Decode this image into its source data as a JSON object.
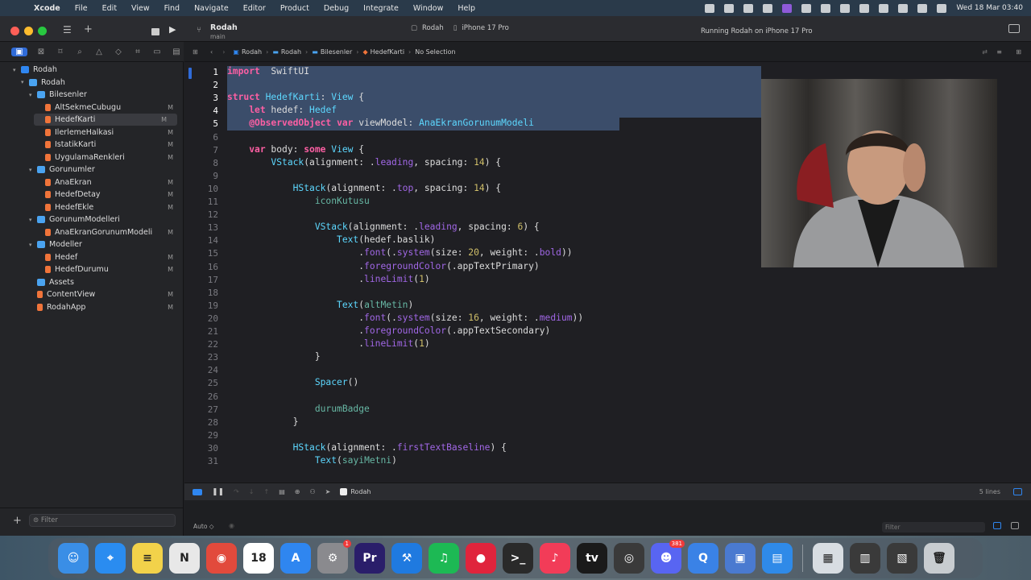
{
  "menubar": {
    "app": "Xcode",
    "items": [
      "File",
      "Edit",
      "View",
      "Find",
      "Navigate",
      "Editor",
      "Product",
      "Debug",
      "Integrate",
      "Window",
      "Help"
    ],
    "clock": "Wed 18 Mar  03:40"
  },
  "toolbar": {
    "project": "Rodah",
    "branch": "main",
    "scheme": "Rodah",
    "device": "iPhone 17 Pro",
    "status": "Running Rodah on iPhone 17 Pro"
  },
  "breadcrumb": {
    "items": [
      "Rodah",
      "Rodah",
      "Bilesenler",
      "HedefKarti"
    ],
    "tail": "No Selection"
  },
  "navigator": {
    "rows": [
      {
        "label": "Rodah",
        "depth": 0,
        "kind": "project",
        "open": true,
        "mark": ""
      },
      {
        "label": "Rodah",
        "depth": 1,
        "kind": "folder",
        "open": true,
        "mark": ""
      },
      {
        "label": "Bilesenler",
        "depth": 2,
        "kind": "folder",
        "open": true,
        "mark": ""
      },
      {
        "label": "AltSekmeCubugu",
        "depth": 3,
        "kind": "swift",
        "mark": "M"
      },
      {
        "label": "HedefKarti",
        "depth": 3,
        "kind": "swift",
        "mark": "M",
        "selected": true
      },
      {
        "label": "IlerlemeHalkasi",
        "depth": 3,
        "kind": "swift",
        "mark": "M"
      },
      {
        "label": "IstatikKarti",
        "depth": 3,
        "kind": "swift",
        "mark": "M"
      },
      {
        "label": "UygulamaRenkleri",
        "depth": 3,
        "kind": "swift",
        "mark": "M"
      },
      {
        "label": "Gorunumler",
        "depth": 2,
        "kind": "folder",
        "open": true,
        "mark": ""
      },
      {
        "label": "AnaEkran",
        "depth": 3,
        "kind": "swift",
        "mark": "M"
      },
      {
        "label": "HedefDetay",
        "depth": 3,
        "kind": "swift",
        "mark": "M"
      },
      {
        "label": "HedefEkle",
        "depth": 3,
        "kind": "swift",
        "mark": "M"
      },
      {
        "label": "GorunumModelleri",
        "depth": 2,
        "kind": "folder",
        "open": true,
        "mark": ""
      },
      {
        "label": "AnaEkranGorunumModeli",
        "depth": 3,
        "kind": "swift",
        "mark": "M"
      },
      {
        "label": "Modeller",
        "depth": 2,
        "kind": "folder",
        "open": true,
        "mark": ""
      },
      {
        "label": "Hedef",
        "depth": 3,
        "kind": "swift",
        "mark": "M"
      },
      {
        "label": "HedefDurumu",
        "depth": 3,
        "kind": "swift",
        "mark": "M"
      },
      {
        "label": "Assets",
        "depth": 2,
        "kind": "assets",
        "mark": ""
      },
      {
        "label": "ContentView",
        "depth": 2,
        "kind": "swift",
        "mark": "M"
      },
      {
        "label": "RodahApp",
        "depth": 2,
        "kind": "swift",
        "mark": "M"
      }
    ],
    "filter_placeholder": "Filter"
  },
  "editor": {
    "selected_lines": [
      1,
      5
    ],
    "lines": [
      [
        [
          "kw",
          "import"
        ],
        [
          "",
          "  SwiftUI"
        ]
      ],
      [],
      [
        [
          "kw",
          "struct"
        ],
        [
          "",
          " "
        ],
        [
          "ty",
          "HedefKarti"
        ],
        [
          "",
          ": "
        ],
        [
          "ty",
          "View"
        ],
        [
          "",
          " {"
        ]
      ],
      [
        [
          "",
          "    "
        ],
        [
          "kw",
          "let"
        ],
        [
          "",
          " hedef: "
        ],
        [
          "ty",
          "Hedef"
        ]
      ],
      [
        [
          "",
          "    "
        ],
        [
          "kw",
          "@ObservedObject"
        ],
        [
          "",
          " "
        ],
        [
          "kw",
          "var"
        ],
        [
          "",
          " viewModel: "
        ],
        [
          "ty",
          "AnaEkranGorunumModeli"
        ]
      ],
      [],
      [
        [
          "",
          "    "
        ],
        [
          "kw",
          "var"
        ],
        [
          "",
          " body: "
        ],
        [
          "kw",
          "some"
        ],
        [
          "",
          " "
        ],
        [
          "ty",
          "View"
        ],
        [
          "",
          " {"
        ]
      ],
      [
        [
          "",
          "        "
        ],
        [
          "ty",
          "VStack"
        ],
        [
          "",
          "(alignment: ."
        ],
        [
          "pr",
          "leading"
        ],
        [
          "",
          ", spacing: "
        ],
        [
          "nm",
          "14"
        ],
        [
          "",
          ") {"
        ]
      ],
      [],
      [
        [
          "",
          "            "
        ],
        [
          "ty",
          "HStack"
        ],
        [
          "",
          "(alignment: ."
        ],
        [
          "pr",
          "top"
        ],
        [
          "",
          ", spacing: "
        ],
        [
          "nm",
          "14"
        ],
        [
          "",
          ") {"
        ]
      ],
      [
        [
          "",
          "                "
        ],
        [
          "fn",
          "iconKutusu"
        ]
      ],
      [],
      [
        [
          "",
          "                "
        ],
        [
          "ty",
          "VStack"
        ],
        [
          "",
          "(alignment: ."
        ],
        [
          "pr",
          "leading"
        ],
        [
          "",
          ", spacing: "
        ],
        [
          "nm",
          "6"
        ],
        [
          "",
          ") {"
        ]
      ],
      [
        [
          "",
          "                    "
        ],
        [
          "ty",
          "Text"
        ],
        [
          "",
          "(hedef.baslik)"
        ]
      ],
      [
        [
          "",
          "                        ."
        ],
        [
          "pr",
          "font"
        ],
        [
          "",
          "(."
        ],
        [
          "pr",
          "system"
        ],
        [
          "",
          "(size: "
        ],
        [
          "nm",
          "20"
        ],
        [
          "",
          ", weight: ."
        ],
        [
          "pr",
          "bold"
        ],
        [
          "",
          "))"
        ]
      ],
      [
        [
          "",
          "                        ."
        ],
        [
          "pr",
          "foregroundColor"
        ],
        [
          "",
          "(.appTextPrimary)"
        ]
      ],
      [
        [
          "",
          "                        ."
        ],
        [
          "pr",
          "lineLimit"
        ],
        [
          "",
          "("
        ],
        [
          "nm",
          "1"
        ],
        [
          "",
          ")"
        ]
      ],
      [],
      [
        [
          "",
          "                    "
        ],
        [
          "ty",
          "Text"
        ],
        [
          "",
          "("
        ],
        [
          "fn",
          "altMetin"
        ],
        [
          "",
          ")"
        ]
      ],
      [
        [
          "",
          "                        ."
        ],
        [
          "pr",
          "font"
        ],
        [
          "",
          "(."
        ],
        [
          "pr",
          "system"
        ],
        [
          "",
          "(size: "
        ],
        [
          "nm",
          "16"
        ],
        [
          "",
          ", weight: ."
        ],
        [
          "pr",
          "medium"
        ],
        [
          "",
          "))"
        ]
      ],
      [
        [
          "",
          "                        ."
        ],
        [
          "pr",
          "foregroundColor"
        ],
        [
          "",
          "(.appTextSecondary)"
        ]
      ],
      [
        [
          "",
          "                        ."
        ],
        [
          "pr",
          "lineLimit"
        ],
        [
          "",
          "("
        ],
        [
          "nm",
          "1"
        ],
        [
          "",
          ")"
        ]
      ],
      [
        [
          "",
          "                }"
        ]
      ],
      [],
      [
        [
          "",
          "                "
        ],
        [
          "ty",
          "Spacer"
        ],
        [
          "",
          "()"
        ]
      ],
      [],
      [
        [
          "",
          "                "
        ],
        [
          "fn",
          "durumBadge"
        ]
      ],
      [
        [
          "",
          "            }"
        ]
      ],
      [],
      [
        [
          "",
          "            "
        ],
        [
          "ty",
          "HStack"
        ],
        [
          "",
          "(alignment: ."
        ],
        [
          "pr",
          "firstTextBaseline"
        ],
        [
          "",
          ") {"
        ]
      ],
      [
        [
          "",
          "                "
        ],
        [
          "ty",
          "Text"
        ],
        [
          "",
          "("
        ],
        [
          "fn",
          "sayiMetni"
        ],
        [
          "",
          ")"
        ]
      ]
    ]
  },
  "debugbar": {
    "target": "Rodah",
    "lines_info": "5 lines"
  },
  "console": {
    "mode": "Auto ◇",
    "filter_placeholder": "Filter"
  },
  "dock": {
    "apps": [
      {
        "name": "finder",
        "glyph": "☺",
        "color": "#3a8ee6"
      },
      {
        "name": "safari",
        "glyph": "⌖",
        "color": "#2a8cf0"
      },
      {
        "name": "notes",
        "glyph": "≡",
        "color": "#f2d24a"
      },
      {
        "name": "news",
        "glyph": "N",
        "color": "#e8e8e8"
      },
      {
        "name": "chrome",
        "glyph": "◉",
        "color": "#e24a3c"
      },
      {
        "name": "calendar",
        "glyph": "18",
        "color": "#ffffff"
      },
      {
        "name": "app-store",
        "glyph": "A",
        "color": "#2f86f0"
      },
      {
        "name": "system-settings",
        "glyph": "⚙",
        "color": "#8a8a8e",
        "badge": "1"
      },
      {
        "name": "premiere",
        "glyph": "Pr",
        "color": "#2a1e6a"
      },
      {
        "name": "xcode",
        "glyph": "⚒",
        "color": "#1f7ae0"
      },
      {
        "name": "spotify",
        "glyph": "♫",
        "color": "#1db954"
      },
      {
        "name": "screen-recorder",
        "glyph": "●",
        "color": "#e0243c"
      },
      {
        "name": "terminal",
        "glyph": ">_",
        "color": "#2a2a2a"
      },
      {
        "name": "music",
        "glyph": "♪",
        "color": "#f23c58"
      },
      {
        "name": "apple-tv",
        "glyph": "tv",
        "color": "#1a1a1a"
      },
      {
        "name": "obs",
        "glyph": "◎",
        "color": "#3a3a3a"
      },
      {
        "name": "discord",
        "glyph": "☻",
        "color": "#5865f2",
        "badge": "381"
      },
      {
        "name": "quicktime",
        "glyph": "Q",
        "color": "#3a82e6"
      },
      {
        "name": "simulator",
        "glyph": "▣",
        "color": "#4a7ad0"
      },
      {
        "name": "files",
        "glyph": "▤",
        "color": "#2f8ae8"
      },
      {
        "name": "preview-docs",
        "glyph": "▦",
        "color": "#d8dde2"
      },
      {
        "name": "window-stack",
        "glyph": "▥",
        "color": "#3a3a3a"
      },
      {
        "name": "window-stack-2",
        "glyph": "▧",
        "color": "#3a3a3a"
      },
      {
        "name": "trash",
        "glyph": "🗑",
        "color": "#c8ccd0"
      }
    ]
  },
  "colors": {
    "accent": "#2f6bd8",
    "selection": "#3b4d6a",
    "keyword": "#fc5fa3",
    "type": "#5dd8ff",
    "property": "#a167e6"
  }
}
